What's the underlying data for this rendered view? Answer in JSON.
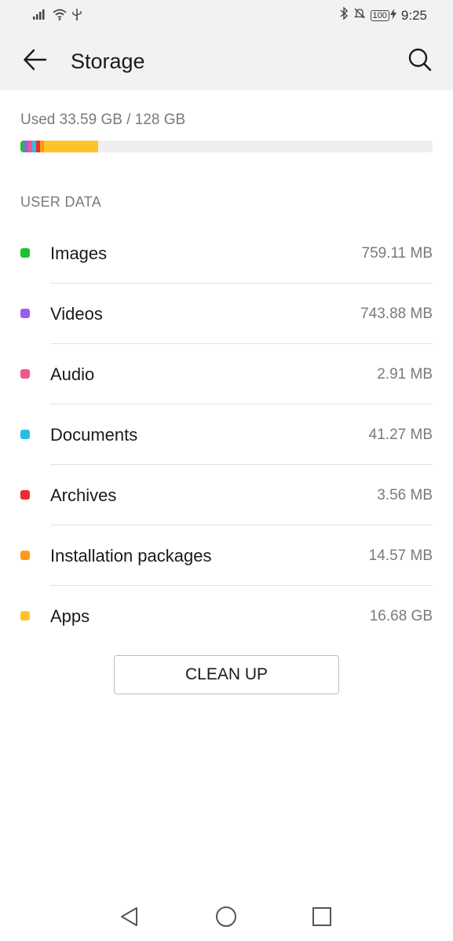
{
  "status_bar": {
    "time": "9:25",
    "battery": "100",
    "icons": [
      "signal-icon",
      "wifi-icon",
      "usb-icon",
      "bluetooth-icon",
      "mute-icon",
      "battery-icon",
      "charging-icon"
    ]
  },
  "header": {
    "title": "Storage",
    "back_icon": "back-arrow-icon",
    "search_icon": "search-icon"
  },
  "summary": {
    "used_text": "Used 33.59 GB / 128 GB",
    "used_fraction": 0.2624
  },
  "colors": {
    "images": "#19c42f",
    "videos": "#9b5cf0",
    "audio": "#f0578f",
    "documents": "#26c0e6",
    "archives": "#ee2c2c",
    "installation_packages": "#ff9a1a",
    "apps": "#ffc32a",
    "bar_track": "#efefef"
  },
  "section": {
    "title": "USER DATA"
  },
  "categories": [
    {
      "label": "Images",
      "size": "759.11 MB",
      "color": "#19c42f"
    },
    {
      "label": "Videos",
      "size": "743.88 MB",
      "color": "#9b5cf0"
    },
    {
      "label": "Audio",
      "size": "2.91 MB",
      "color": "#f0578f"
    },
    {
      "label": "Documents",
      "size": "41.27 MB",
      "color": "#26c0e6"
    },
    {
      "label": "Archives",
      "size": "3.56 MB",
      "color": "#ee2c2c"
    },
    {
      "label": "Installation packages",
      "size": "14.57 MB",
      "color": "#ff9a1a"
    },
    {
      "label": "Apps",
      "size": "16.68 GB",
      "color": "#ffc32a"
    }
  ],
  "actions": {
    "clean_up": "CLEAN UP"
  },
  "nav_bar": {
    "icons": [
      "nav-back-icon",
      "nav-home-icon",
      "nav-recents-icon"
    ]
  }
}
